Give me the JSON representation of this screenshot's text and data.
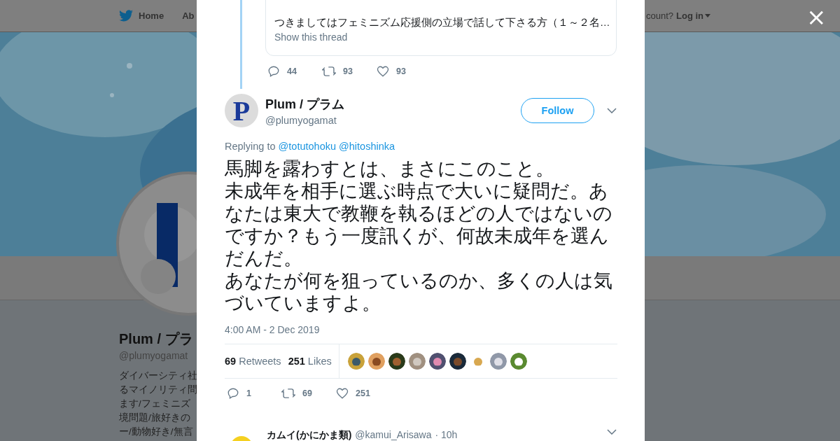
{
  "background_page": {
    "nav": {
      "home": "Home",
      "about": "Ab",
      "account_prompt": "count?",
      "login": "Log in"
    },
    "profile": {
      "name": "Plum / プラ",
      "handle": "@plumyogamat",
      "bio_lines": [
        "ダイバーシティ社",
        "るマイノリティ問",
        "ます/フェミニズ",
        "境問題/旅好きの",
        "ー/動物好き/無言"
      ]
    }
  },
  "modal": {
    "close": "×",
    "parent_tweet": {
      "quoted_text": "つきましてはフェミニズム応援側の立場で話して下さる方（１～２名…",
      "show_thread": "Show this thread",
      "actions": [
        {
          "kind": "reply",
          "count": "44"
        },
        {
          "kind": "retweet",
          "count": "93"
        },
        {
          "kind": "like",
          "count": "93"
        }
      ]
    },
    "tweet": {
      "avatar_letter": "P",
      "name": "Plum / プラム",
      "handle": "@plumyogamat",
      "follow": "Follow",
      "replying_to": "Replying to",
      "mentions": [
        "@totutohoku",
        "@hitoshinka"
      ],
      "text_paragraphs": [
        "馬脚を露わすとは、まさにこのこと。",
        "未成年を相手に選ぶ時点で大いに疑問だ。あなたは東大で教鞭を執るほどの人ではないのですか？もう一度訊くが、何故未成年を選んだんだ。",
        "あなたが何を狙っているのか、多くの人は気づいていますよ。"
      ],
      "timestamp": "4:00 AM - 2 Dec 2019",
      "stats": [
        {
          "count": "69",
          "label": "Retweets"
        },
        {
          "count": "251",
          "label": "Likes"
        }
      ],
      "liker_avatars": [
        {
          "kind": "picture"
        },
        {
          "kind": "picture"
        },
        {
          "kind": "picture"
        },
        {
          "kind": "picture"
        },
        {
          "kind": "picture"
        },
        {
          "kind": "picture"
        },
        {
          "kind": "picture"
        },
        {
          "kind": "picture"
        },
        {
          "kind": "picture"
        }
      ],
      "actions": [
        {
          "kind": "reply",
          "count": "1"
        },
        {
          "kind": "retweet",
          "count": "69"
        },
        {
          "kind": "like",
          "count": "251"
        }
      ]
    },
    "next_reply": {
      "name": "カムイ(かにかま類)",
      "handle": "@kamui_Arisawa",
      "time": "· 10h"
    }
  }
}
